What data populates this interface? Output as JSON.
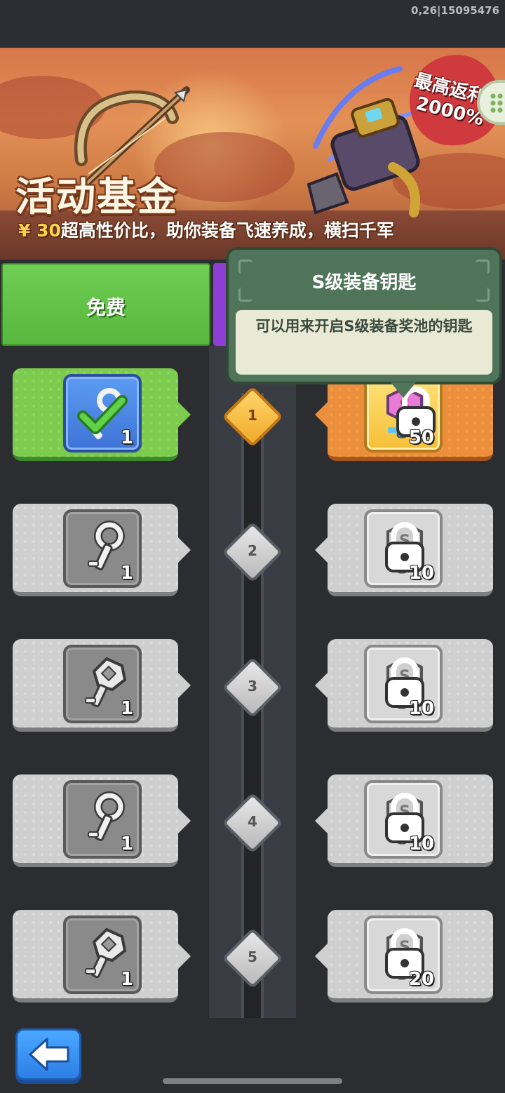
{
  "status_bar": {
    "build_id": "0,26|15095476"
  },
  "banner": {
    "title": "活动基金",
    "subtitle_price": "¥ 30",
    "subtitle_text": "超高性价比，助你装备飞速养成，横扫千军",
    "rebate_line1": "最高返利",
    "rebate_line2": "2000%"
  },
  "headers": {
    "free": "免费"
  },
  "tooltip": {
    "title": "S级装备钥匙",
    "description": "可以用来开启S级装备奖池的钥匙"
  },
  "rows": [
    {
      "level": "1",
      "free_qty": "1",
      "free_item": "claimed-key-icon",
      "paid_qty": "50",
      "paid_item": "rainbow-s-key-icon",
      "active": true
    },
    {
      "level": "2",
      "free_qty": "1",
      "free_item": "silver-key-icon",
      "paid_qty": "10",
      "paid_item": "s-key-icon",
      "active": false
    },
    {
      "level": "3",
      "free_qty": "1",
      "free_item": "ornate-key-icon",
      "paid_qty": "10",
      "paid_item": "s-key-icon",
      "active": false
    },
    {
      "level": "4",
      "free_qty": "1",
      "free_item": "silver-key-icon",
      "paid_qty": "10",
      "paid_item": "s-key-icon",
      "active": false
    },
    {
      "level": "5",
      "free_qty": "1",
      "free_item": "ornate-key-icon",
      "paid_qty": "20",
      "paid_item": "s-key-icon",
      "active": false
    }
  ],
  "colors": {
    "free_green": "#6fce53",
    "paid_purple": "#8e3fd3",
    "tooltip_green": "#4f7459",
    "active_orange": "#ec8f3c"
  }
}
